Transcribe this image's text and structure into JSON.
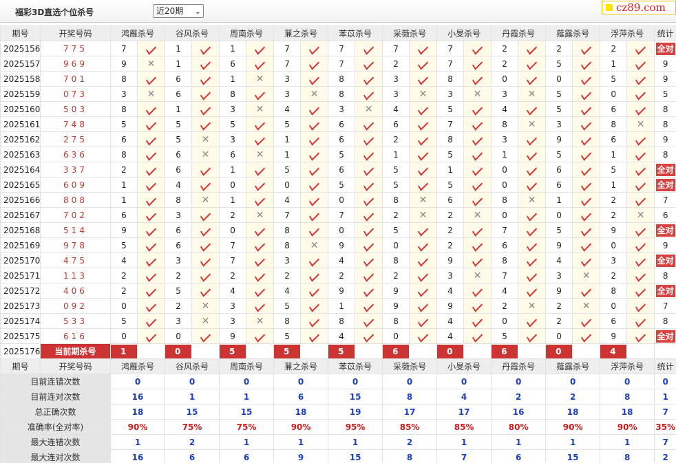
{
  "header": {
    "title": "福彩3D直选个位杀号",
    "period_selected": "近20期",
    "logo": "cz89.com"
  },
  "columns": [
    "期号",
    "开奖号码",
    "鸿雁杀号",
    "谷风杀号",
    "周南杀号",
    "蒹之杀号",
    "苯苡杀号",
    "采薇杀号",
    "小旻杀号",
    "丹霞杀号",
    "薤露杀号",
    "浮萍杀号",
    "统计"
  ],
  "all_correct_label": "全对",
  "rows": [
    {
      "issue": "2025156",
      "num": "775",
      "kills": [
        [
          "7",
          true
        ],
        [
          "1",
          true
        ],
        [
          "1",
          true
        ],
        [
          "7",
          true
        ],
        [
          "7",
          true
        ],
        [
          "7",
          true
        ],
        [
          "7",
          true
        ],
        [
          "2",
          true
        ],
        [
          "2",
          true
        ],
        [
          "2",
          true
        ]
      ],
      "stat": "全对"
    },
    {
      "issue": "2025157",
      "num": "969",
      "kills": [
        [
          "9",
          false
        ],
        [
          "1",
          true
        ],
        [
          "6",
          true
        ],
        [
          "7",
          true
        ],
        [
          "7",
          true
        ],
        [
          "2",
          true
        ],
        [
          "7",
          true
        ],
        [
          "2",
          true
        ],
        [
          "5",
          true
        ],
        [
          "1",
          true
        ]
      ],
      "stat": "9"
    },
    {
      "issue": "2025158",
      "num": "701",
      "kills": [
        [
          "8",
          true
        ],
        [
          "6",
          true
        ],
        [
          "1",
          false
        ],
        [
          "3",
          true
        ],
        [
          "8",
          true
        ],
        [
          "3",
          true
        ],
        [
          "8",
          true
        ],
        [
          "0",
          true
        ],
        [
          "0",
          true
        ],
        [
          "5",
          true
        ]
      ],
      "stat": "9"
    },
    {
      "issue": "2025159",
      "num": "073",
      "kills": [
        [
          "3",
          false
        ],
        [
          "6",
          true
        ],
        [
          "8",
          true
        ],
        [
          "3",
          false
        ],
        [
          "8",
          true
        ],
        [
          "3",
          false
        ],
        [
          "3",
          false
        ],
        [
          "3",
          false
        ],
        [
          "5",
          true
        ],
        [
          "0",
          true
        ]
      ],
      "stat": "5"
    },
    {
      "issue": "2025160",
      "num": "503",
      "kills": [
        [
          "8",
          true
        ],
        [
          "1",
          true
        ],
        [
          "3",
          false
        ],
        [
          "4",
          true
        ],
        [
          "3",
          false
        ],
        [
          "4",
          true
        ],
        [
          "5",
          true
        ],
        [
          "4",
          true
        ],
        [
          "5",
          true
        ],
        [
          "6",
          true
        ]
      ],
      "stat": "8"
    },
    {
      "issue": "2025161",
      "num": "748",
      "kills": [
        [
          "5",
          true
        ],
        [
          "5",
          true
        ],
        [
          "5",
          true
        ],
        [
          "5",
          true
        ],
        [
          "6",
          true
        ],
        [
          "6",
          true
        ],
        [
          "7",
          true
        ],
        [
          "8",
          false
        ],
        [
          "3",
          true
        ],
        [
          "8",
          false
        ]
      ],
      "stat": "8"
    },
    {
      "issue": "2025162",
      "num": "275",
      "kills": [
        [
          "6",
          true
        ],
        [
          "5",
          false
        ],
        [
          "3",
          true
        ],
        [
          "1",
          true
        ],
        [
          "6",
          true
        ],
        [
          "2",
          true
        ],
        [
          "8",
          true
        ],
        [
          "3",
          true
        ],
        [
          "9",
          true
        ],
        [
          "6",
          true
        ]
      ],
      "stat": "9"
    },
    {
      "issue": "2025163",
      "num": "636",
      "kills": [
        [
          "8",
          true
        ],
        [
          "6",
          false
        ],
        [
          "6",
          false
        ],
        [
          "1",
          true
        ],
        [
          "5",
          true
        ],
        [
          "1",
          true
        ],
        [
          "5",
          true
        ],
        [
          "1",
          true
        ],
        [
          "5",
          true
        ],
        [
          "1",
          true
        ]
      ],
      "stat": "8"
    },
    {
      "issue": "2025164",
      "num": "337",
      "kills": [
        [
          "2",
          true
        ],
        [
          "6",
          true
        ],
        [
          "1",
          true
        ],
        [
          "5",
          true
        ],
        [
          "6",
          true
        ],
        [
          "5",
          true
        ],
        [
          "1",
          true
        ],
        [
          "0",
          true
        ],
        [
          "6",
          true
        ],
        [
          "5",
          true
        ]
      ],
      "stat": "全对"
    },
    {
      "issue": "2025165",
      "num": "609",
      "kills": [
        [
          "1",
          true
        ],
        [
          "4",
          true
        ],
        [
          "0",
          true
        ],
        [
          "0",
          true
        ],
        [
          "5",
          true
        ],
        [
          "5",
          true
        ],
        [
          "5",
          true
        ],
        [
          "0",
          true
        ],
        [
          "6",
          true
        ],
        [
          "1",
          true
        ]
      ],
      "stat": "全对"
    },
    {
      "issue": "2025166",
      "num": "808",
      "kills": [
        [
          "1",
          true
        ],
        [
          "8",
          false
        ],
        [
          "1",
          true
        ],
        [
          "4",
          true
        ],
        [
          "0",
          true
        ],
        [
          "8",
          false
        ],
        [
          "6",
          true
        ],
        [
          "8",
          false
        ],
        [
          "1",
          true
        ],
        [
          "2",
          true
        ]
      ],
      "stat": "7"
    },
    {
      "issue": "2025167",
      "num": "702",
      "kills": [
        [
          "6",
          true
        ],
        [
          "3",
          true
        ],
        [
          "2",
          false
        ],
        [
          "7",
          true
        ],
        [
          "7",
          true
        ],
        [
          "2",
          false
        ],
        [
          "2",
          false
        ],
        [
          "0",
          true
        ],
        [
          "0",
          true
        ],
        [
          "2",
          false
        ]
      ],
      "stat": "6"
    },
    {
      "issue": "2025168",
      "num": "514",
      "kills": [
        [
          "9",
          true
        ],
        [
          "6",
          true
        ],
        [
          "0",
          true
        ],
        [
          "8",
          true
        ],
        [
          "0",
          true
        ],
        [
          "5",
          true
        ],
        [
          "2",
          true
        ],
        [
          "7",
          true
        ],
        [
          "5",
          true
        ],
        [
          "9",
          true
        ]
      ],
      "stat": "全对"
    },
    {
      "issue": "2025169",
      "num": "978",
      "kills": [
        [
          "5",
          true
        ],
        [
          "6",
          true
        ],
        [
          "7",
          true
        ],
        [
          "8",
          false
        ],
        [
          "9",
          true
        ],
        [
          "0",
          true
        ],
        [
          "2",
          true
        ],
        [
          "6",
          true
        ],
        [
          "9",
          true
        ],
        [
          "0",
          true
        ]
      ],
      "stat": "9"
    },
    {
      "issue": "2025170",
      "num": "475",
      "kills": [
        [
          "4",
          true
        ],
        [
          "3",
          true
        ],
        [
          "7",
          true
        ],
        [
          "3",
          true
        ],
        [
          "4",
          true
        ],
        [
          "8",
          true
        ],
        [
          "9",
          true
        ],
        [
          "8",
          true
        ],
        [
          "4",
          true
        ],
        [
          "3",
          true
        ]
      ],
      "stat": "全对"
    },
    {
      "issue": "2025171",
      "num": "113",
      "kills": [
        [
          "2",
          true
        ],
        [
          "2",
          true
        ],
        [
          "2",
          true
        ],
        [
          "2",
          true
        ],
        [
          "2",
          true
        ],
        [
          "2",
          true
        ],
        [
          "3",
          false
        ],
        [
          "7",
          true
        ],
        [
          "3",
          false
        ],
        [
          "2",
          true
        ]
      ],
      "stat": "8"
    },
    {
      "issue": "2025172",
      "num": "406",
      "kills": [
        [
          "2",
          true
        ],
        [
          "5",
          true
        ],
        [
          "4",
          true
        ],
        [
          "4",
          true
        ],
        [
          "9",
          true
        ],
        [
          "9",
          true
        ],
        [
          "4",
          true
        ],
        [
          "4",
          true
        ],
        [
          "9",
          true
        ],
        [
          "8",
          true
        ]
      ],
      "stat": "全对"
    },
    {
      "issue": "2025173",
      "num": "092",
      "kills": [
        [
          "0",
          true
        ],
        [
          "2",
          false
        ],
        [
          "3",
          true
        ],
        [
          "5",
          true
        ],
        [
          "1",
          true
        ],
        [
          "9",
          true
        ],
        [
          "9",
          true
        ],
        [
          "2",
          false
        ],
        [
          "2",
          false
        ],
        [
          "0",
          true
        ]
      ],
      "stat": "7"
    },
    {
      "issue": "2025174",
      "num": "533",
      "kills": [
        [
          "5",
          true
        ],
        [
          "3",
          false
        ],
        [
          "3",
          false
        ],
        [
          "8",
          true
        ],
        [
          "8",
          true
        ],
        [
          "8",
          true
        ],
        [
          "4",
          true
        ],
        [
          "0",
          true
        ],
        [
          "2",
          true
        ],
        [
          "6",
          true
        ]
      ],
      "stat": "8"
    },
    {
      "issue": "2025175",
      "num": "616",
      "kills": [
        [
          "0",
          true
        ],
        [
          "0",
          true
        ],
        [
          "9",
          true
        ],
        [
          "5",
          true
        ],
        [
          "4",
          true
        ],
        [
          "0",
          true
        ],
        [
          "4",
          true
        ],
        [
          "5",
          true
        ],
        [
          "0",
          true
        ],
        [
          "9",
          true
        ]
      ],
      "stat": "全对"
    }
  ],
  "current": {
    "issue": "2025176",
    "label": "当前期杀号",
    "kills": [
      "1",
      "0",
      "5",
      "5",
      "5",
      "6",
      "0",
      "6",
      "0",
      "4"
    ]
  },
  "summary": [
    {
      "label": "目前连错次数",
      "values": [
        "0",
        "0",
        "0",
        "0",
        "0",
        "0",
        "0",
        "0",
        "0",
        "0",
        "0"
      ]
    },
    {
      "label": "目前连对次数",
      "values": [
        "16",
        "1",
        "1",
        "6",
        "15",
        "8",
        "4",
        "2",
        "2",
        "8",
        "1"
      ]
    },
    {
      "label": "总正确次数",
      "values": [
        "18",
        "15",
        "15",
        "18",
        "19",
        "17",
        "17",
        "16",
        "18",
        "18",
        "7"
      ]
    },
    {
      "label": "准确率(全对率)",
      "values": [
        "90%",
        "75%",
        "75%",
        "90%",
        "95%",
        "85%",
        "85%",
        "80%",
        "90%",
        "90%",
        "35%"
      ]
    },
    {
      "label": "最大连错次数",
      "values": [
        "1",
        "2",
        "1",
        "1",
        "1",
        "2",
        "1",
        "1",
        "1",
        "1",
        "7"
      ]
    },
    {
      "label": "最大连对次数",
      "values": [
        "16",
        "6",
        "6",
        "9",
        "15",
        "8",
        "7",
        "6",
        "15",
        "8",
        "2"
      ]
    }
  ]
}
